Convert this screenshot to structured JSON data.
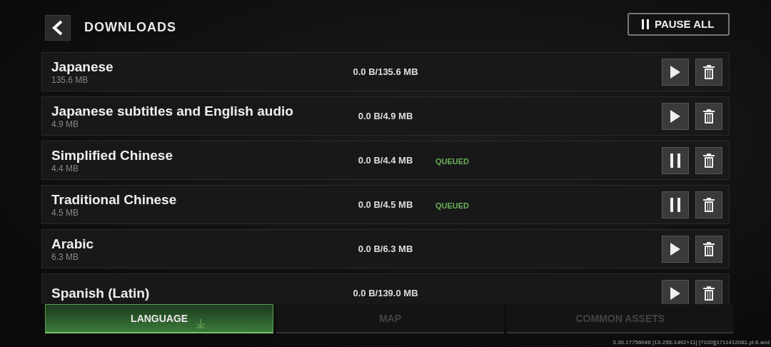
{
  "header": {
    "title": "DOWNLOADS",
    "pause_all": "PAUSE ALL"
  },
  "downloads": [
    {
      "name": "Japanese",
      "size": "135.6 MB",
      "progress": "0.0 B/135.6 MB",
      "queued": false
    },
    {
      "name": "Japanese subtitles and English audio",
      "size": "4.9 MB",
      "progress": "0.0 B/4.9 MB",
      "queued": false
    },
    {
      "name": "Simplified Chinese",
      "size": "4.4 MB",
      "progress": "0.0 B/4.4 MB",
      "status": "QUEUED",
      "queued": true
    },
    {
      "name": "Traditional Chinese",
      "size": "4.5 MB",
      "progress": "0.0 B/4.5 MB",
      "status": "QUEUED",
      "queued": true
    },
    {
      "name": "Arabic",
      "size": "6.3 MB",
      "progress": "0.0 B/6.3 MB",
      "queued": false
    },
    {
      "name": "Spanish (Latin)",
      "progress": "0.0 B/139.0 MB",
      "queued": false
    }
  ],
  "tabs": [
    {
      "label": "LANGUAGE",
      "selected": true
    },
    {
      "label": "MAP",
      "selected": false
    },
    {
      "label": "COMMON ASSETS",
      "selected": false
    }
  ],
  "build_info": "3.30.17756046 [13-255-1492+11] [7100][1711412081.pl.6.and"
}
